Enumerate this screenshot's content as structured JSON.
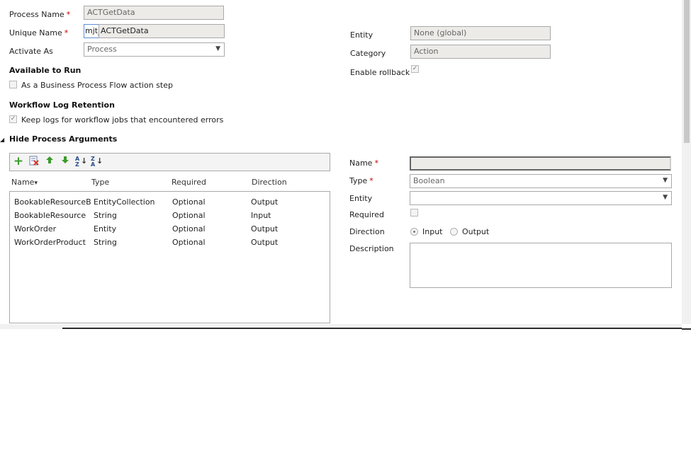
{
  "general": {
    "process_name_label": "Process Name",
    "process_name_value": "ACTGetData",
    "unique_name_label": "Unique Name",
    "unique_name_prefix": "mjt_",
    "unique_name_value": "ACTGetData",
    "activate_as_label": "Activate As",
    "activate_as_value": "Process",
    "entity_label": "Entity",
    "entity_value": "None (global)",
    "category_label": "Category",
    "category_value": "Action",
    "enable_rollback_label": "Enable rollback",
    "required_marker": "*"
  },
  "available_to_run": {
    "heading": "Available to Run",
    "bpf_checkbox_label": "As a Business Process Flow action step"
  },
  "log_retention": {
    "heading": "Workflow Log Retention",
    "keep_logs_label": "Keep logs for workflow jobs that encountered errors"
  },
  "arguments": {
    "toggle_label": "Hide Process Arguments",
    "columns": [
      "Name",
      "Type",
      "Required",
      "Direction"
    ],
    "sort_glyph": "▾",
    "rows": [
      {
        "name": "BookableResourceB...",
        "type": "EntityCollection",
        "required": "Optional",
        "direction": "Output"
      },
      {
        "name": "BookableResource",
        "type": "String",
        "required": "Optional",
        "direction": "Input"
      },
      {
        "name": "WorkOrder",
        "type": "Entity",
        "required": "Optional",
        "direction": "Output"
      },
      {
        "name": "WorkOrderProduct",
        "type": "String",
        "required": "Optional",
        "direction": "Output"
      }
    ]
  },
  "detail": {
    "name_label": "Name",
    "name_value": "",
    "type_label": "Type",
    "type_value": "Boolean",
    "entity_label": "Entity",
    "entity_value": "",
    "required_label": "Required",
    "direction_label": "Direction",
    "direction_input": "Input",
    "direction_output": "Output",
    "description_label": "Description",
    "description_value": ""
  },
  "icons": {
    "add": "+",
    "sort_az_top": "A",
    "sort_az_bottom": "Z",
    "sort_za_top": "Z",
    "sort_za_bottom": "A"
  },
  "colors": {
    "required": "#c00000",
    "add_icon": "#3a9b2a",
    "remove_icon": "#d23a2a"
  }
}
